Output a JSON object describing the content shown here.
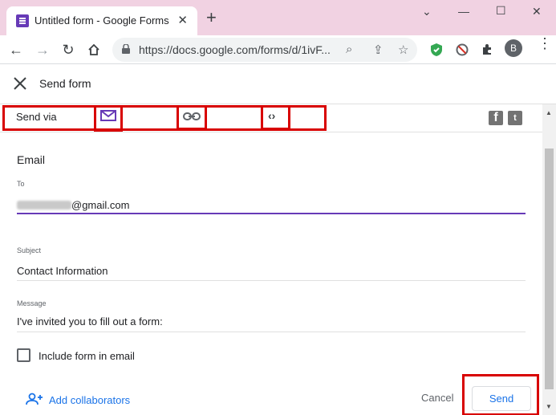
{
  "browser": {
    "tab_title": "Untitled form - Google Forms",
    "url": "https://docs.google.com/forms/d/1ivF...",
    "profile_initial": "B"
  },
  "dialog": {
    "title": "Send form",
    "send_via_label": "Send via",
    "send_methods": [
      "email-icon",
      "link-icon",
      "embed-icon"
    ],
    "social_icons": [
      "facebook-icon",
      "twitter-icon"
    ]
  },
  "email": {
    "heading": "Email",
    "to_label": "To",
    "to_value_visible": "@gmail.com",
    "subject_label": "Subject",
    "subject_value": "Contact Information",
    "message_label": "Message",
    "message_value": "I've invited you to fill out a form:",
    "include_form_label": "Include form in email",
    "include_form_checked": false
  },
  "footer": {
    "add_collaborators": "Add collaborators",
    "cancel": "Cancel",
    "send": "Send"
  },
  "colors": {
    "accent_purple": "#673ab7",
    "link_blue": "#1a73e8",
    "highlight_red": "#d80000"
  }
}
